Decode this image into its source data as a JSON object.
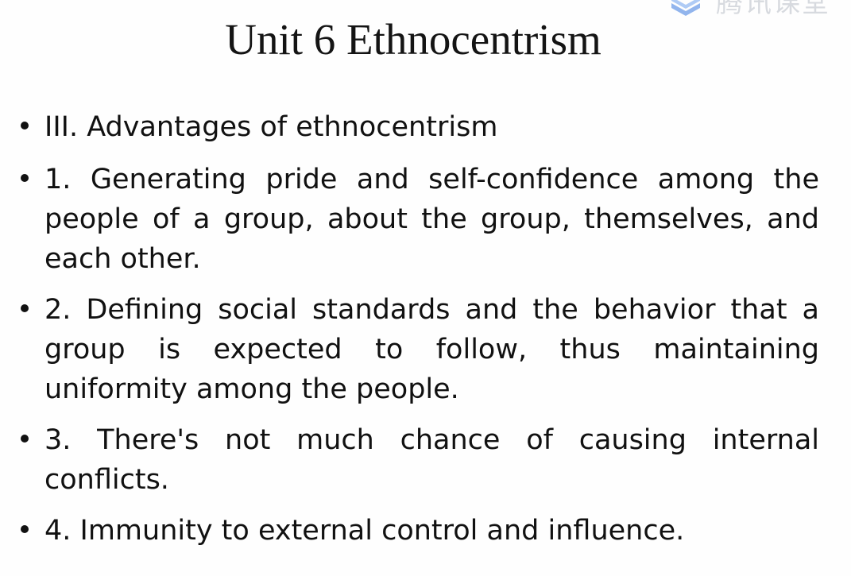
{
  "slide": {
    "title": "Unit 6 Ethnocentrism",
    "watermark": {
      "text": "腾讯课堂",
      "icon": "tencent-classroom-logo-icon"
    },
    "bullets": [
      {
        "lines": [
          "III.  Advantages of ethnocentrism"
        ]
      },
      {
        "lines": [
          "1. Generating pride and self-confidence among the",
          "people of a group, about the group, themselves, and",
          "each other."
        ]
      },
      {
        "lines": [
          "2. Defining social standards and the behavior that a",
          "group is expected to follow, thus maintaining",
          "uniformity among the people."
        ]
      },
      {
        "lines": [
          "3. There's not much chance of causing internal",
          "conflicts."
        ]
      },
      {
        "lines": [
          "4. Immunity to external control and influence."
        ]
      }
    ],
    "colors": {
      "text": "#111111",
      "background": "#ffffff",
      "watermark": "#b9bec6",
      "watermark_logo": "#3b7be0"
    }
  }
}
